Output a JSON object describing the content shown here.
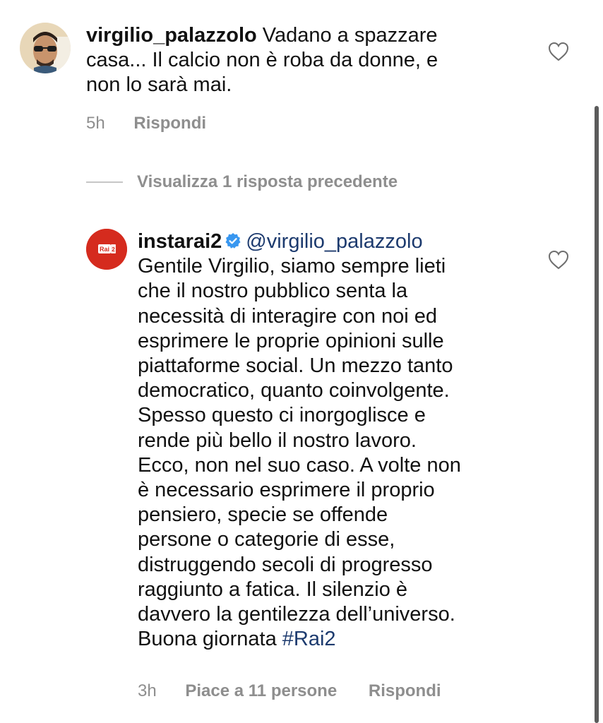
{
  "comment1": {
    "username": "virgilio_palazzolo",
    "text": " Vadano a spazzare\ncasa... Il calcio non è roba da donne, e\nnon lo sarà mai.",
    "time": "5h",
    "reply_label": "Rispondi",
    "avatar_icon": "user-avatar-photo"
  },
  "view_replies": {
    "label": "Visualizza 1 risposta precedente"
  },
  "comment2": {
    "username": "instarai2",
    "mention": "@virgilio_palazzolo",
    "avatar_logo_text": "Rai 2",
    "text": "\nGentile Virgilio, siamo sempre lieti\nche il nostro pubblico senta la\nnecessità di interagire con noi ed\nesprimere le proprie opinioni sulle\npiattaforme social. Un mezzo tanto\ndemocratico, quanto coinvolgente.\nSpesso questo ci inorgoglisce e\nrende più bello il nostro lavoro.\nEcco, non nel suo caso. A volte non\nè necessario esprimere il proprio\npensiero, specie se offende\npersone o categorie di esse,\ndistruggendo secoli di progresso\nraggiunto a fatica. Il silenzio è\ndavvero la gentilezza dell’universo.\nBuona giornata ",
    "hashtag": "#Rai2",
    "time": "3h",
    "likes_label": "Piace a 11 persone",
    "reply_label": "Rispondi"
  },
  "colors": {
    "link": "#1c3a6e",
    "meta_gray": "#8e8e8e",
    "verified_blue": "#3897f0",
    "rai_red": "#d52b1e"
  }
}
